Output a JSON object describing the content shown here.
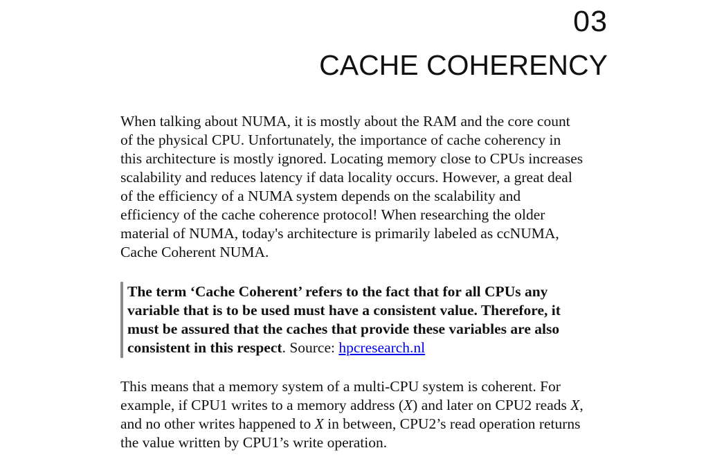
{
  "chapter": {
    "number": "03",
    "title": "CACHE COHERENCY"
  },
  "paragraph_1": {
    "lines": [
      "When talking about NUMA, it is mostly about the RAM and the core count",
      "of the physical CPU. Unfortunately, the importance of cache coherency in",
      "this architecture is mostly ignored. Locating memory close to CPUs increases",
      "scalability and reduces latency if data locality occurs. However, a great deal",
      "of the efficiency of a NUMA system depends on the scalability and",
      "efficiency of the cache coherence protocol! When researching the older",
      "material of NUMA, today's architecture is primarily labeled as ccNUMA,",
      "Cache Coherent NUMA."
    ]
  },
  "quote": {
    "bold_lines": [
      "The term ‘Cache Coherent’ refers to the fact that for all CPUs any",
      "variable that is to be used must have a consistent value. Therefore, it",
      "must be assured that the caches that provide these variables are also",
      "consistent in this respect"
    ],
    "source_prefix": ". Source: ",
    "source_link": "hpcresearch.nl"
  },
  "paragraph_2": {
    "line_1": "This means that a memory system of a multi-CPU system is coherent. For",
    "line_2_a": "example, if CPU1 writes to a memory address (",
    "line_2_var1": "X",
    "line_2_b": ") and later on CPU2 reads ",
    "line_2_var2": "X",
    "line_2_c": ",",
    "line_3_a": "and no other writes happened to ",
    "line_3_var": "X",
    "line_3_b": " in between, CPU2’s read operation returns",
    "line_4": "the value written by CPU1’s write operation."
  }
}
